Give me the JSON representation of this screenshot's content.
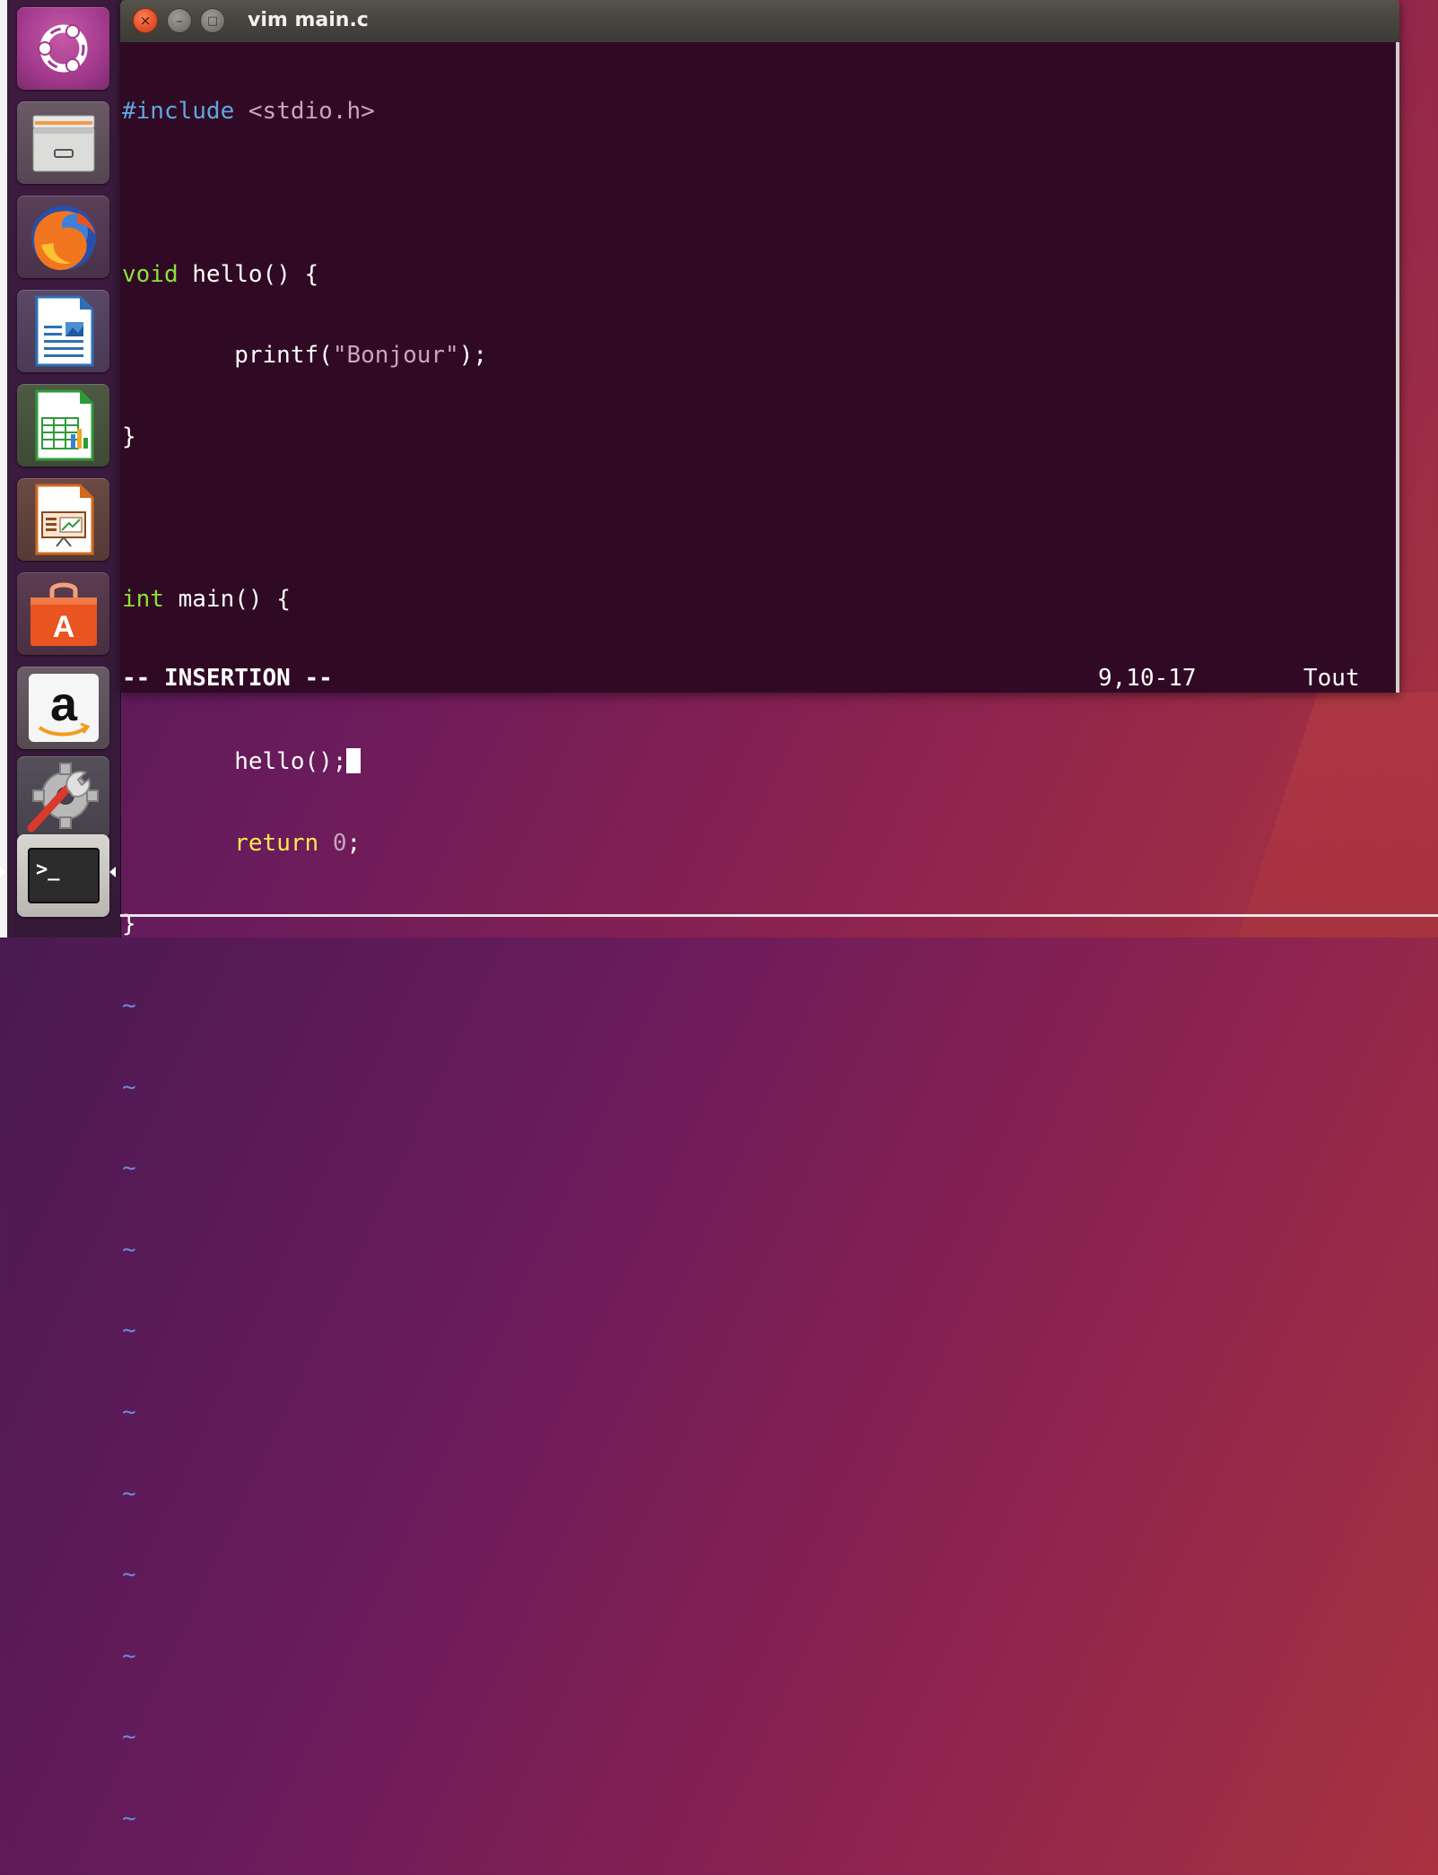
{
  "window": {
    "title": "vim main.c",
    "close_glyph": "×",
    "min_glyph": "–",
    "max_glyph": "□"
  },
  "launcher": {
    "items": [
      {
        "name": "ubuntu-dash",
        "icon": "ubuntu-logo-icon"
      },
      {
        "name": "files",
        "icon": "file-cabinet-icon"
      },
      {
        "name": "firefox",
        "icon": "firefox-icon"
      },
      {
        "name": "libreoffice-writer",
        "icon": "writer-document-icon"
      },
      {
        "name": "libreoffice-calc",
        "icon": "calc-spreadsheet-icon"
      },
      {
        "name": "libreoffice-impress",
        "icon": "impress-presentation-icon"
      },
      {
        "name": "ubuntu-software",
        "icon": "shopping-bag-icon"
      },
      {
        "name": "amazon",
        "icon": "amazon-icon"
      },
      {
        "name": "system-settings",
        "icon": "gear-wrench-icon"
      },
      {
        "name": "terminal",
        "icon": "terminal-icon",
        "active": true
      }
    ],
    "amazon_letter": "a",
    "software_letter": "A",
    "terminal_prompt": ">_"
  },
  "editor": {
    "lines": {
      "l1_pre": "#include",
      "l1_header": " <stdio.h>",
      "l3_type": "void",
      "l3_rest": " hello() {",
      "l4_indent": "        printf(",
      "l4_str": "\"Bonjour\"",
      "l4_end": ");",
      "l5": "}",
      "l7_type": "int",
      "l7_rest": " main() {",
      "l9_code": "        hello();",
      "l10_indent": "        ",
      "l10_kw": "return",
      "l10_sp": " ",
      "l10_num": "0",
      "l10_end": ";",
      "l11": "}"
    },
    "tilde": "~",
    "mode": "-- INSERTION --",
    "position": "9,10-17",
    "scroll": "Tout"
  },
  "colors": {
    "terminal_bg": "#300a24",
    "preprocessor": "#5fa7e0",
    "type": "#8ae234",
    "keyword": "#fce94f",
    "string": "#c9a4bd",
    "tilde": "#6d8bd8"
  }
}
